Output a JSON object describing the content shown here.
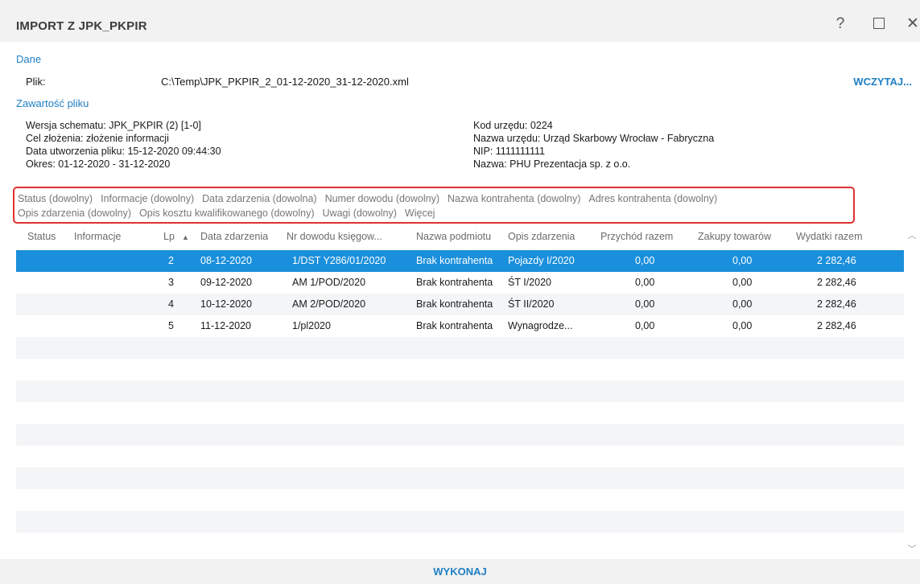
{
  "window": {
    "title": "IMPORT Z JPK_PKPIR",
    "help_label": "?",
    "close_label": "✕"
  },
  "dane": {
    "section_label": "Dane",
    "plik_label": "Plik:",
    "file_path": "C:\\Temp\\JPK_PKPIR_2_01-12-2020_31-12-2020.xml",
    "load_button": "WCZYTAJ..."
  },
  "zawartosc": {
    "section_label": "Zawartość pliku",
    "left": [
      "Wersja schematu: JPK_PKPIR (2) [1-0]",
      "Cel złożenia: złożenie informacji",
      "Data utworzenia pliku: 15-12-2020 09:44:30",
      "Okres: 01-12-2020 - 31-12-2020"
    ],
    "right": [
      "Kod urzędu: 0224",
      "Nazwa urzędu: Urząd Skarbowy Wrocław - Fabryczna",
      "NIP: 1111111111",
      "Nazwa: PHU Prezentacja sp. z o.o."
    ]
  },
  "filters": [
    "Status (dowolny)",
    "Informacje (dowolny)",
    "Data zdarzenia (dowolna)",
    "Numer dowodu (dowolny)",
    "Nazwa kontrahenta (dowolny)",
    "Adres kontrahenta (dowolny)",
    "Opis zdarzenia (dowolny)",
    "Opis kosztu kwalifikowanego (dowolny)",
    "Uwagi (dowolny)",
    "Więcej"
  ],
  "table": {
    "headers": {
      "status": "Status",
      "informacje": "Informacje",
      "lp": "Lp",
      "sort_indicator": "▲",
      "data": "Data zdarzenia",
      "nr": "Nr dowodu księgow...",
      "nazwa": "Nazwa podmiotu",
      "opis": "Opis zdarzenia",
      "przychod": "Przychód razem",
      "zakupy": "Zakupy towarów",
      "wydatki": "Wydatki razem"
    },
    "rows": [
      {
        "lp": "2",
        "data": "08-12-2020",
        "nr": "1/DST Y286/01/2020",
        "nazwa": "Brak kontrahenta",
        "opis": "Pojazdy I/2020",
        "przychod": "0,00",
        "zakupy": "0,00",
        "wydatki": "2 282,46"
      },
      {
        "lp": "3",
        "data": "09-12-2020",
        "nr": "AM 1/POD/2020",
        "nazwa": "Brak kontrahenta",
        "opis": "ŚT I/2020",
        "przychod": "0,00",
        "zakupy": "0,00",
        "wydatki": "2 282,46"
      },
      {
        "lp": "4",
        "data": "10-12-2020",
        "nr": "AM 2/POD/2020",
        "nazwa": "Brak kontrahenta",
        "opis": "ŚT II/2020",
        "przychod": "0,00",
        "zakupy": "0,00",
        "wydatki": "2 282,46"
      },
      {
        "lp": "5",
        "data": "11-12-2020",
        "nr": "1/pl2020",
        "nazwa": "Brak kontrahenta",
        "opis": "Wynagrodze...",
        "przychod": "0,00",
        "zakupy": "0,00",
        "wydatki": "2 282,46"
      }
    ]
  },
  "footer": {
    "execute_button": "WYKONAJ"
  },
  "colors": {
    "accent": "#1f7fc4",
    "selected_row": "#1a8fdc",
    "filter_border": "#e03030"
  }
}
